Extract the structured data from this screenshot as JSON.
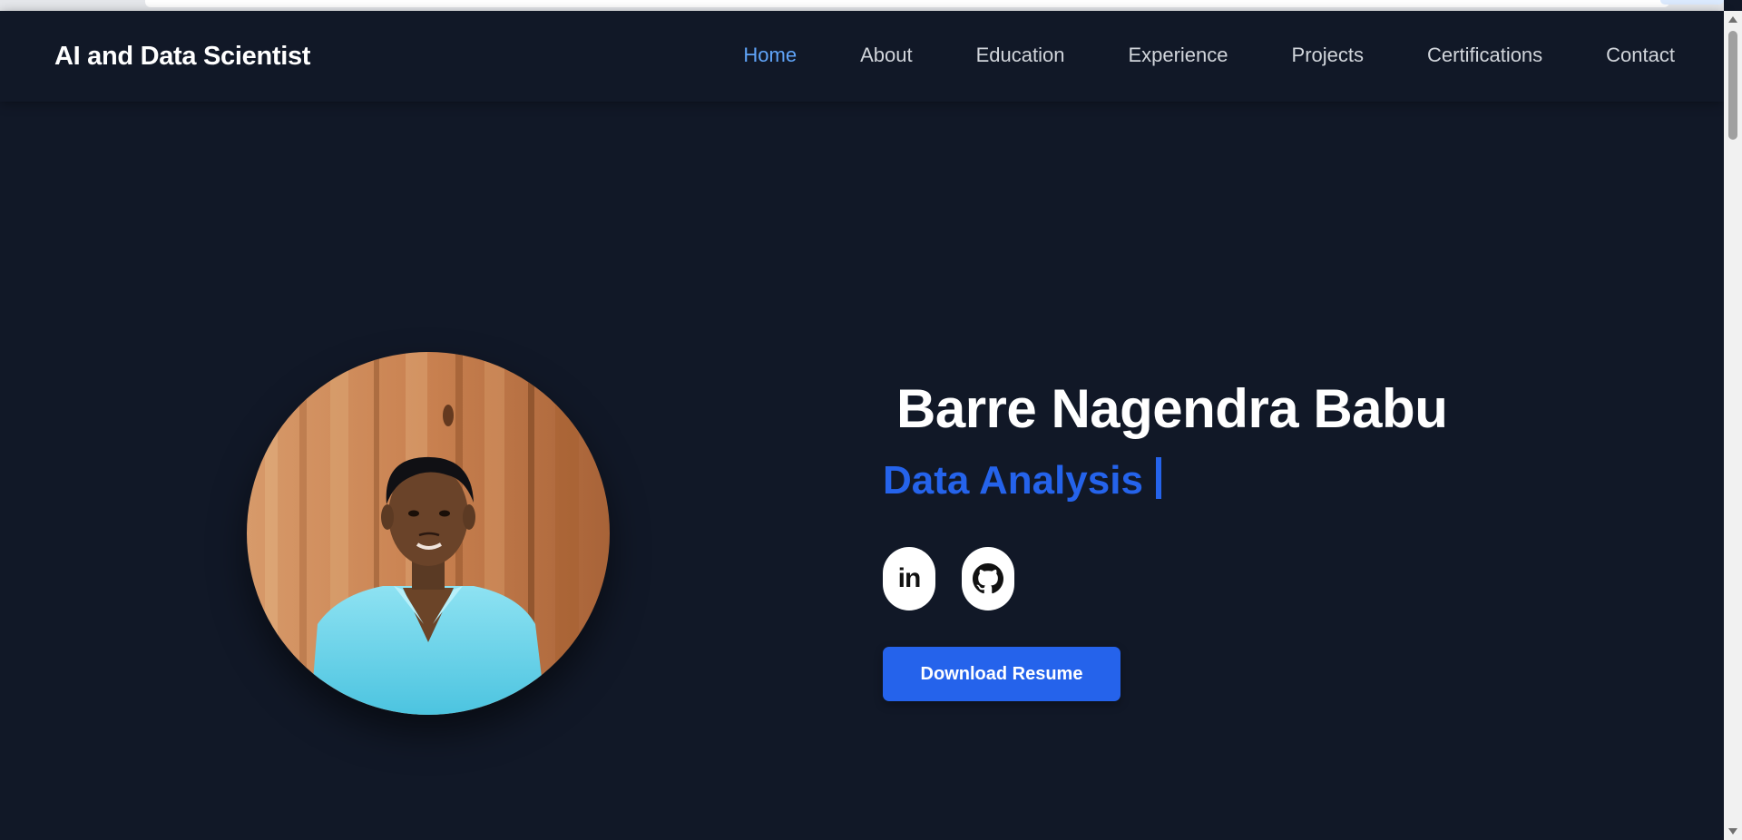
{
  "brand": {
    "title": "AI and Data Scientist"
  },
  "nav": {
    "items": [
      {
        "label": "Home",
        "active": true
      },
      {
        "label": "About",
        "active": false
      },
      {
        "label": "Education",
        "active": false
      },
      {
        "label": "Experience",
        "active": false
      },
      {
        "label": "Projects",
        "active": false
      },
      {
        "label": "Certifications",
        "active": false
      },
      {
        "label": "Contact",
        "active": false
      }
    ]
  },
  "hero": {
    "name": "Barre Nagendra Babu",
    "role": "Data Analysis",
    "social": [
      {
        "icon": "linkedin-icon",
        "text": "in"
      },
      {
        "icon": "github-icon"
      }
    ],
    "download_label": "Download Resume"
  },
  "colors": {
    "background": "#111827",
    "accent": "#2563eb",
    "nav_active": "#60a5fa",
    "nav_text": "#d1d5db",
    "text": "#ffffff"
  }
}
